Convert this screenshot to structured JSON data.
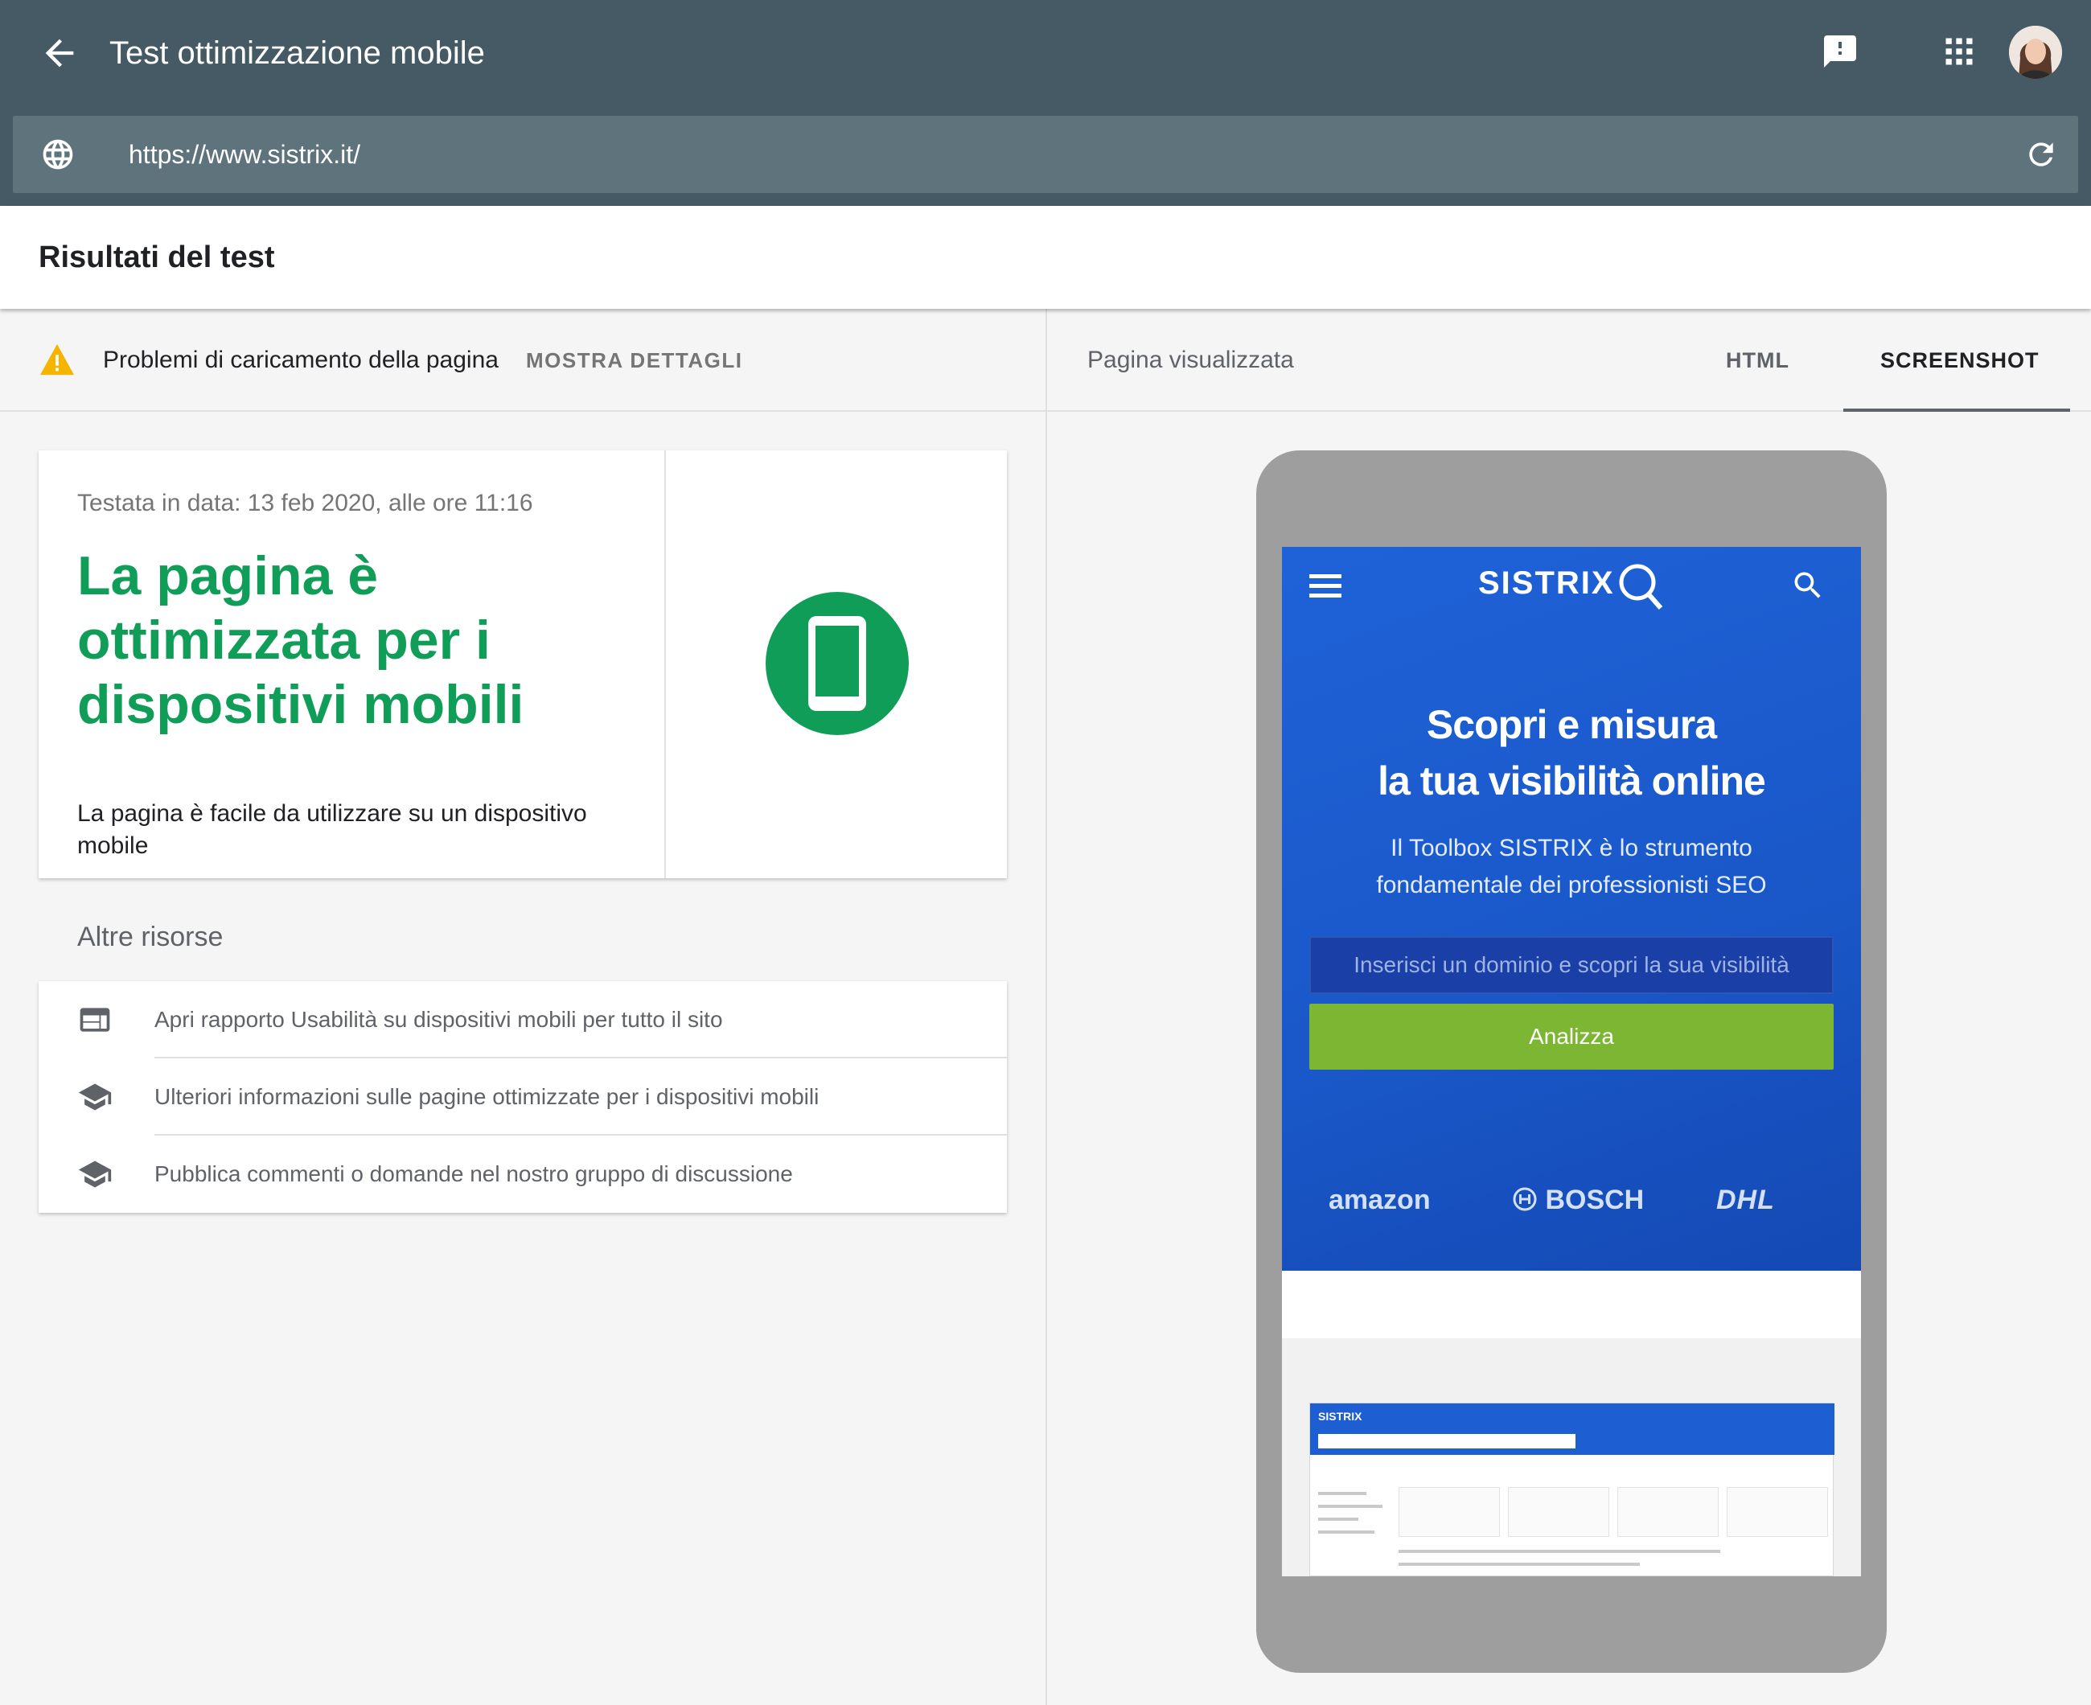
{
  "appbar": {
    "title": "Test ottimizzazione mobile",
    "back_icon": "arrow-back-icon",
    "feedback_icon": "feedback-icon",
    "apps_icon": "apps-grid-icon"
  },
  "urlbar": {
    "url": "https://www.sistrix.it/",
    "globe_icon": "globe-icon",
    "reload_icon": "reload-icon"
  },
  "results": {
    "title": "Risultati del test"
  },
  "status": {
    "message": "Problemi di caricamento della pagina",
    "details_label": "MOSTRA DETTAGLI"
  },
  "card": {
    "date": "Testata in data: 13 feb 2020, alle ore 11:16",
    "headline": "La pagina è ottimizzata per i dispositivi mobili",
    "description": "La pagina è facile da utilizzare su un dispositivo mobile"
  },
  "other": {
    "title": "Altre risorse",
    "items": [
      {
        "label": "Apri rapporto Usabilità su dispositivi mobili per tutto il sito",
        "icon": "web-report-icon"
      },
      {
        "label": "Ulteriori informazioni sulle pagine ottimizzate per i dispositivi mobili",
        "icon": "school-icon"
      },
      {
        "label": "Pubblica commenti o domande nel nostro gruppo di discussione",
        "icon": "school-icon"
      }
    ]
  },
  "rendered": {
    "label": "Pagina visualizzata",
    "tabs": [
      {
        "label": "HTML",
        "selected": false
      },
      {
        "label": "SCREENSHOT",
        "selected": true
      }
    ]
  },
  "phone": {
    "logo": "SISTRIX",
    "headline_line1": "Scopri e misura",
    "headline_line2": "la tua visibilità online",
    "lead_line1": "Il Toolbox SISTRIX è lo strumento",
    "lead_line2": "fondamentale dei professionisti SEO",
    "input_placeholder": "Inserisci un dominio e scopri la sua visibilità",
    "button": "Analizza",
    "brands": [
      "amazon",
      "BOSCH",
      "DHL"
    ],
    "mini_logo": "SISTRIX"
  },
  "colors": {
    "appbar": "#455a64",
    "success": "#0f9d58",
    "warning": "#f4b400",
    "hero_blue": "#1f62d8",
    "button_green": "#7cb633"
  }
}
